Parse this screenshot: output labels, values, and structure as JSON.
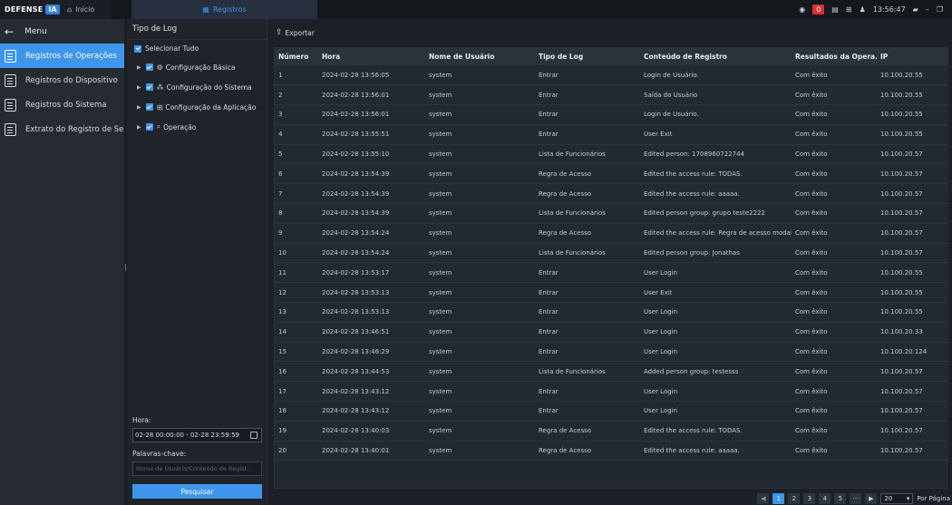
{
  "topbar": {
    "brand_word": "DEFENSE",
    "brand_ia": "IA",
    "home_tab": "Início",
    "registros_tab": "Registros",
    "alarm_count": "0",
    "clock": "13:56:47"
  },
  "menu": {
    "title": "Menu",
    "items": [
      {
        "label": "Registros de Operações"
      },
      {
        "label": "Registros do Dispositivo"
      },
      {
        "label": "Registros do Sistema"
      },
      {
        "label": "Extrato do Registro de Se..."
      }
    ]
  },
  "filter": {
    "title": "Tipo de Log",
    "select_all": "Selecionar Tudo",
    "tree": [
      {
        "label": "Configuração Básica"
      },
      {
        "label": "Configuração do Sistema"
      },
      {
        "label": "Configuração da Aplicação"
      },
      {
        "label": "Operação"
      }
    ],
    "hora_label": "Hora:",
    "hora_value": "02-28 00:00:00 - 02-28 23:59:59",
    "keywords_label": "Palavras-chave:",
    "keywords_placeholder": "Nome de Usuário/Conteúdo de Regist...",
    "search_button": "Pesquisar"
  },
  "main": {
    "export_label": "Exportar"
  },
  "table": {
    "columns": [
      "Número",
      "Hora",
      "Nome de Usuário",
      "Tipo de Log",
      "Conteúdo de Registro",
      "Resultados da Opera...",
      "IP"
    ],
    "rows": [
      [
        "1",
        "2024-02-28 13:56:05",
        "system",
        "Entrar",
        "Login de Usuário.",
        "Com êxito",
        "10.100.20.55"
      ],
      [
        "2",
        "2024-02-28 13:56:01",
        "system",
        "Entrar",
        "Saída do Usuário",
        "Com êxito",
        "10.100.20.55"
      ],
      [
        "3",
        "2024-02-28 13:56:01",
        "system",
        "Entrar",
        "Login de Usuário.",
        "Com êxito",
        "10.100.20.55"
      ],
      [
        "4",
        "2024-02-28 13:55:51",
        "system",
        "Entrar",
        "User Exit",
        "Com êxito",
        "10.100.20.55"
      ],
      [
        "5",
        "2024-02-28 13:55:10",
        "system",
        "Lista de Funcionários",
        "Edited person: 1708960722744",
        "Com êxito",
        "10.100.20.57"
      ],
      [
        "6",
        "2024-02-28 13:54:39",
        "system",
        "Regra de Acesso",
        "Edited the access rule: TODAS.",
        "Com êxito",
        "10.100.20.57"
      ],
      [
        "7",
        "2024-02-28 13:54:39",
        "system",
        "Regra de Acesso",
        "Edited the access rule: aaaaa.",
        "Com êxito",
        "10.100.20.57"
      ],
      [
        "8",
        "2024-02-28 13:54:39",
        "system",
        "Lista de Funcionários",
        "Edited person group: grupo teste2222",
        "Com êxito",
        "10.100.20.57"
      ],
      [
        "9",
        "2024-02-28 13:54:24",
        "system",
        "Regra de Acesso",
        "Edited the access rule: Regra de acesso modal.",
        "Com êxito",
        "10.100.20.57"
      ],
      [
        "10",
        "2024-02-28 13:54:24",
        "system",
        "Lista de Funcionários",
        "Edited person group: Jonathas",
        "Com êxito",
        "10.100.20.57"
      ],
      [
        "11",
        "2024-02-28 13:53:17",
        "system",
        "Entrar",
        "User Login",
        "Com êxito",
        "10.100.20.55"
      ],
      [
        "12",
        "2024-02-28 13:53:13",
        "system",
        "Entrar",
        "User Exit",
        "Com êxito",
        "10.100.20.55"
      ],
      [
        "13",
        "2024-02-28 13:53:13",
        "system",
        "Entrar",
        "User Login",
        "Com êxito",
        "10.100.20.55"
      ],
      [
        "14",
        "2024-02-28 13:46:51",
        "system",
        "Entrar",
        "User Login",
        "Com êxito",
        "10.100.20.33"
      ],
      [
        "15",
        "2024-02-28 13:46:29",
        "system",
        "Entrar",
        "User Login",
        "Com êxito",
        "10.100.20.124"
      ],
      [
        "16",
        "2024-02-28 13:44:53",
        "system",
        "Lista de Funcionários",
        "Added person group: testesss",
        "Com êxito",
        "10.100.20.57"
      ],
      [
        "17",
        "2024-02-28 13:43:12",
        "system",
        "Entrar",
        "User Login",
        "Com êxito",
        "10.100.20.57"
      ],
      [
        "18",
        "2024-02-28 13:43:12",
        "system",
        "Entrar",
        "User Login",
        "Com êxito",
        "10.100.20.57"
      ],
      [
        "19",
        "2024-02-28 13:40:03",
        "system",
        "Regra de Acesso",
        "Edited the access rule: TODAS.",
        "Com êxito",
        "10.100.20.57"
      ],
      [
        "20",
        "2024-02-28 13:40:01",
        "system",
        "Regra de Acesso",
        "Edited the access rule: aaaaa.",
        "Com êxito",
        "10.100.20.57"
      ]
    ]
  },
  "pagination": {
    "pages": [
      "1",
      "2",
      "3",
      "4",
      "5"
    ],
    "ellipsis": "···",
    "page_size": "20",
    "per_page_label": "Por Página"
  }
}
